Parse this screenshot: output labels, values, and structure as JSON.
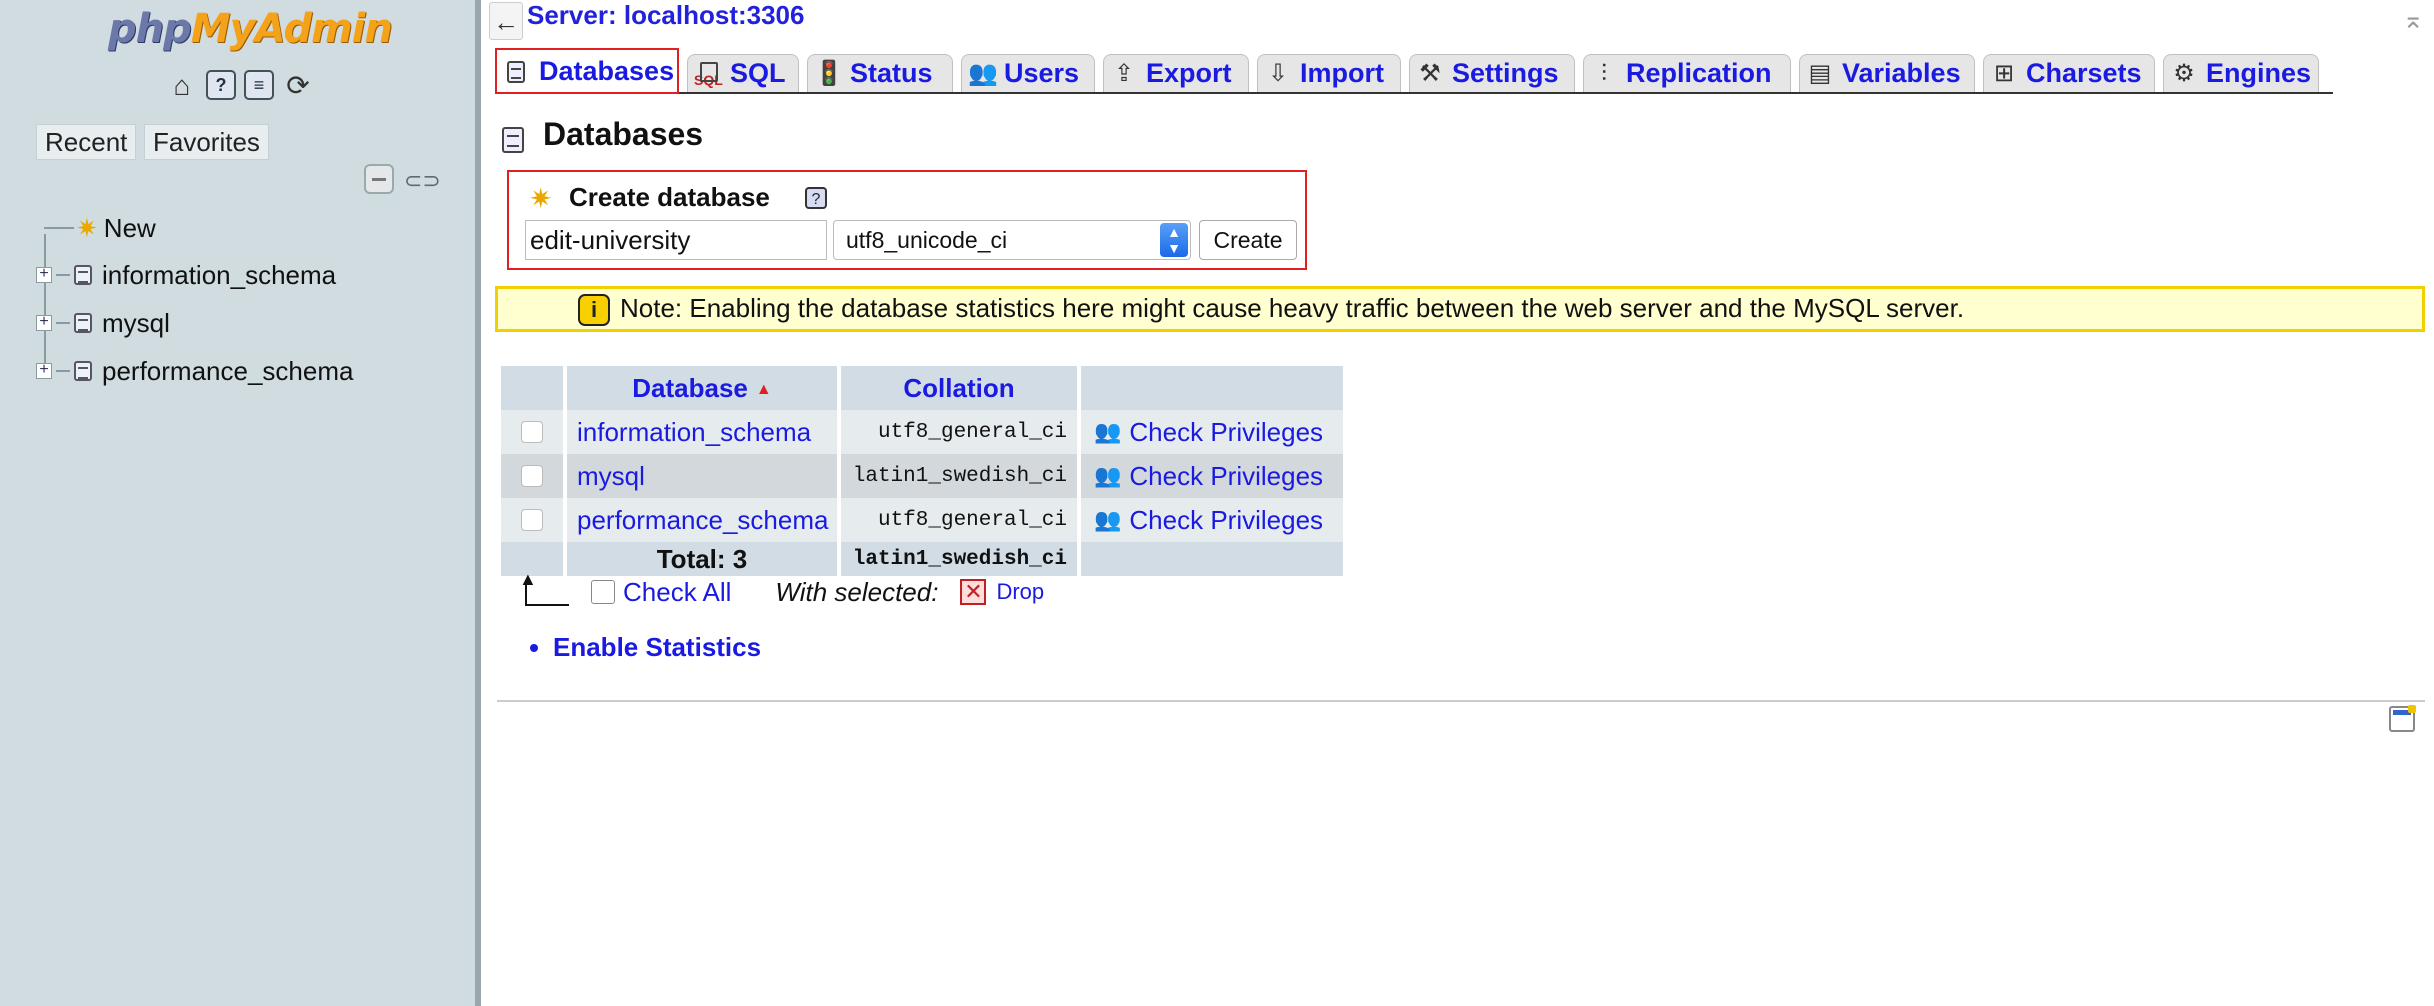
{
  "nav": {
    "logo_php": "php",
    "logo_myadmin": "MyAdmin",
    "icons": [
      "home-icon",
      "help-icon",
      "sql-docs-icon",
      "reload-icon"
    ],
    "recent_tab": "Recent",
    "favorites_tab": "Favorites",
    "tree": {
      "new_label": "New",
      "databases": [
        "information_schema",
        "mysql",
        "performance_schema"
      ]
    }
  },
  "header": {
    "back_arrow": "←",
    "server_title": "Server: localhost:3306"
  },
  "tabs": [
    {
      "label": "Databases",
      "icon": "database-icon",
      "active": true
    },
    {
      "label": "SQL",
      "icon": "sql-icon"
    },
    {
      "label": "Status",
      "icon": "status-icon"
    },
    {
      "label": "Users",
      "icon": "users-icon"
    },
    {
      "label": "Export",
      "icon": "export-icon"
    },
    {
      "label": "Import",
      "icon": "import-icon"
    },
    {
      "label": "Settings",
      "icon": "settings-icon"
    },
    {
      "label": "Replication",
      "icon": "replication-icon"
    },
    {
      "label": "Variables",
      "icon": "variables-icon"
    },
    {
      "label": "Charsets",
      "icon": "charsets-icon"
    },
    {
      "label": "Engines",
      "icon": "engines-icon"
    }
  ],
  "page": {
    "heading": "Databases",
    "create": {
      "title": "Create database",
      "help": "?",
      "name_value": "edit-university",
      "collation_value": "utf8_unicode_ci",
      "button": "Create"
    },
    "note": {
      "icon": "i",
      "text": "Note: Enabling the database statistics here might cause heavy traffic between the web server and the MySQL server."
    },
    "table": {
      "headers": {
        "database": "Database",
        "collation": "Collation"
      },
      "rows": [
        {
          "database": "information_schema",
          "collation": "utf8_general_ci",
          "action": "Check Privileges"
        },
        {
          "database": "mysql",
          "collation": "latin1_swedish_ci",
          "action": "Check Privileges"
        },
        {
          "database": "performance_schema",
          "collation": "utf8_general_ci",
          "action": "Check Privileges"
        }
      ],
      "total_label": "Total: 3",
      "total_collation": "latin1_swedish_ci"
    },
    "with_selected": {
      "check_all": "Check All",
      "label": "With selected:",
      "drop": "Drop"
    },
    "enable_statistics": "Enable Statistics"
  },
  "colors": {
    "link": "#1a1ae0",
    "nav_bg": "#d0dce0",
    "highlight_border": "#e02020",
    "note_border": "#f0d000",
    "note_bg": "#ffffd0"
  }
}
